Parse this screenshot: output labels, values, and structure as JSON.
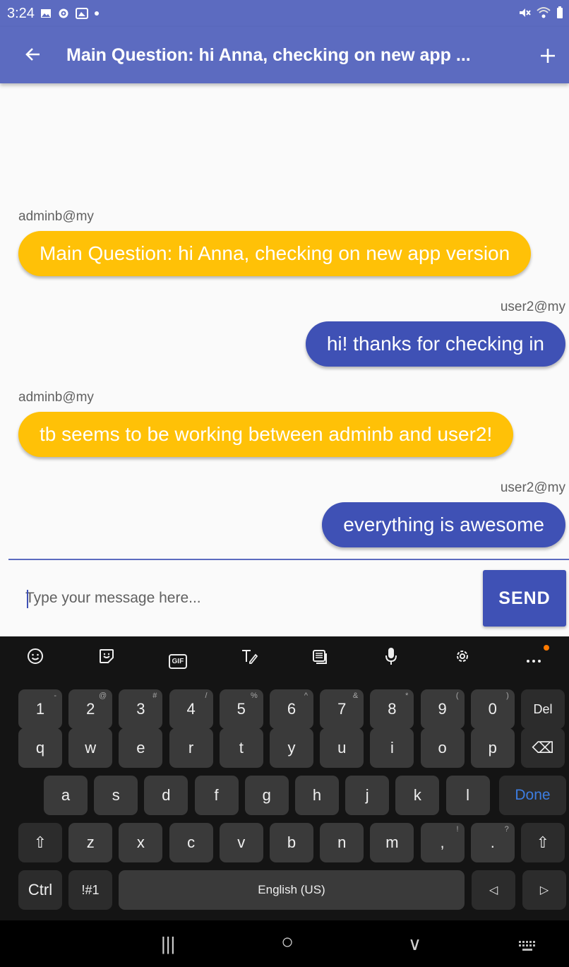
{
  "status_bar": {
    "time": "3:24",
    "left_icons": [
      "image-icon",
      "gear-icon",
      "gallery-icon",
      "dot-icon"
    ],
    "right_icons": [
      "mute-icon",
      "wifi-icon",
      "battery-icon"
    ]
  },
  "app_bar": {
    "title": "Main Question: hi Anna, checking on new app ...",
    "back_icon": "arrow-left-icon",
    "add_icon": "plus-icon"
  },
  "messages": [
    {
      "sender": "adminb@my",
      "text": "Main Question: hi Anna, checking on new app version",
      "direction": "incoming"
    },
    {
      "sender": "user2@my",
      "text": "hi! thanks for checking in",
      "direction": "outgoing"
    },
    {
      "sender": "adminb@my",
      "text": "tb seems to be working between adminb and user2!",
      "direction": "incoming"
    },
    {
      "sender": "user2@my",
      "text": "everything is awesome",
      "direction": "outgoing"
    }
  ],
  "compose": {
    "placeholder": "Type your message here...",
    "value": "",
    "send_label": "SEND"
  },
  "keyboard": {
    "toolbar": [
      "emoji-icon",
      "sticker-icon",
      "gif-icon",
      "handwriting-icon",
      "clipboard-icon",
      "mic-icon",
      "settings-icon",
      "more-icon"
    ],
    "gif_label": "GIF",
    "row1": [
      {
        "k": "1",
        "s": "-"
      },
      {
        "k": "2",
        "s": "@"
      },
      {
        "k": "3",
        "s": "#"
      },
      {
        "k": "4",
        "s": "/"
      },
      {
        "k": "5",
        "s": "%"
      },
      {
        "k": "6",
        "s": "^"
      },
      {
        "k": "7",
        "s": "&"
      },
      {
        "k": "8",
        "s": "*"
      },
      {
        "k": "9",
        "s": "("
      },
      {
        "k": "0",
        "s": ")"
      },
      {
        "k": "Del",
        "s": ""
      }
    ],
    "row2": [
      "q",
      "w",
      "e",
      "r",
      "t",
      "y",
      "u",
      "i",
      "o",
      "p",
      "⌫"
    ],
    "row3": [
      "a",
      "s",
      "d",
      "f",
      "g",
      "h",
      "j",
      "k",
      "l",
      "Done"
    ],
    "row4": [
      "⇧",
      "z",
      "x",
      "c",
      "v",
      "b",
      "n",
      "m",
      ",",
      ".",
      "⇧"
    ],
    "row4_subs": {
      "8": "!",
      "9": "?"
    },
    "row5": {
      "ctrl": "Ctrl",
      "symbols": "!#1",
      "space": "English (US)",
      "left": "◁",
      "right": "▷"
    },
    "accent_color": "#3d7de2"
  },
  "nav_bar": {
    "recents": "|||",
    "home": "○",
    "back": "∨",
    "keyboard": "keyboard-icon"
  },
  "colors": {
    "primary": "#5c6bc0",
    "outgoing": "#3f51b5",
    "incoming": "#ffc107"
  }
}
